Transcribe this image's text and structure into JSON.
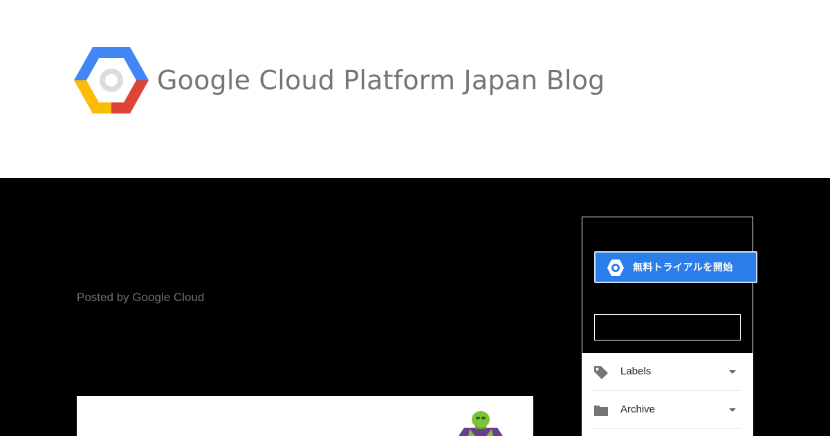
{
  "header": {
    "logo_icon": "google-cloud-hexagon-icon",
    "title": "Google Cloud Platform Japan Blog"
  },
  "post": {
    "byline": "Posted by Google Cloud",
    "image_icon": "green-character-figure"
  },
  "sidebar": {
    "trial_button": {
      "icon": "google-cloud-hexagon-icon",
      "label": "無料トライアルを開始"
    },
    "search": {
      "value": "",
      "placeholder": ""
    },
    "widgets": [
      {
        "icon": "label-tag-icon",
        "label": "Labels"
      },
      {
        "icon": "folder-icon",
        "label": "Archive"
      }
    ]
  },
  "colors": {
    "header_bg": "#ffffff",
    "page_bg": "#000000",
    "title_text": "#757575",
    "byline_text": "#6f6f6f",
    "trial_button_bg": "#2b7de9",
    "logo_blue": "#4285f4",
    "logo_red": "#db4437",
    "logo_yellow": "#fbbc05"
  }
}
